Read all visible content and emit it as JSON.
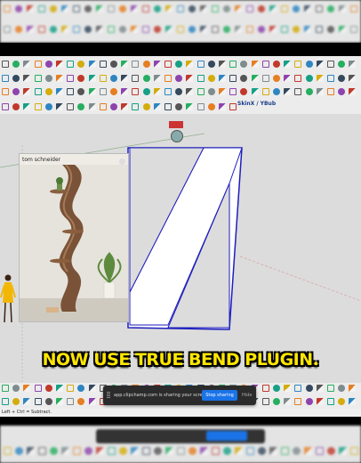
{
  "video": {
    "caption": "NOW USE TRUE BEND PLUGIN.",
    "caption_color": "#ffe600"
  },
  "toolbar": {
    "skinx_label": "SkinX / YBub"
  },
  "reference_image": {
    "author": "tom schneider",
    "back_icon": "chevron-left-icon",
    "subject": "spiral-shelf-photo"
  },
  "screen_share": {
    "message": "app.clipchamp.com is sharing your screen.",
    "stop_label": "Stop sharing",
    "hide_label": "Hide"
  },
  "status_bar": {
    "hint": "Left + Ctrl = Subtract."
  },
  "colors": {
    "selection_blue": "#1e1ebe",
    "viewport_bg": "#dcdcdc",
    "toolbar_bg": "#ececec",
    "share_button": "#1a73e8"
  }
}
